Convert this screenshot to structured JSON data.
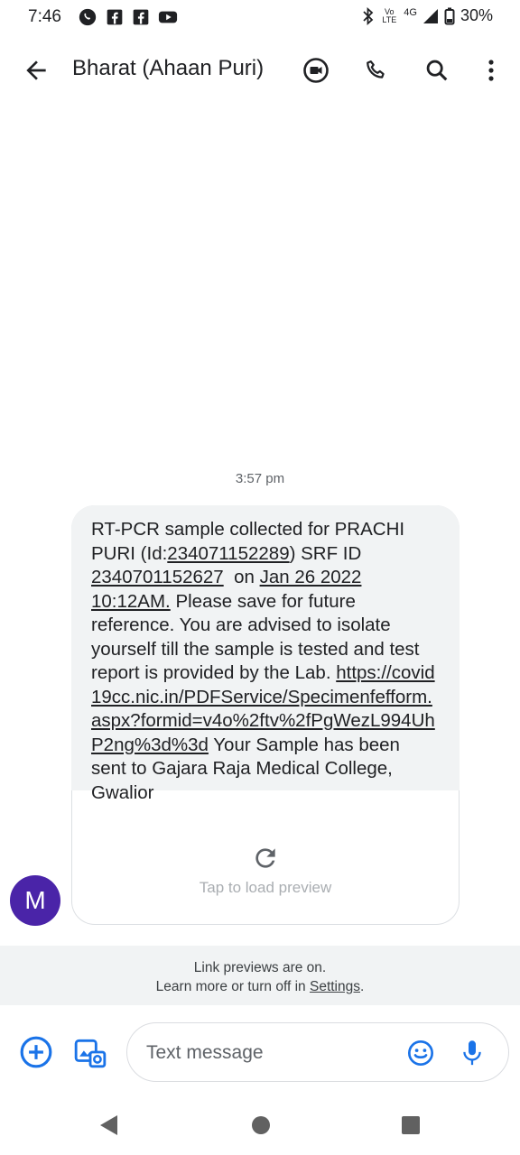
{
  "status_bar": {
    "time": "7:46",
    "battery": "30%",
    "network": "4G",
    "volte_top": "Vo",
    "volte_bottom": "LTE"
  },
  "app_bar": {
    "title": "Bharat (Ahaan Puri)"
  },
  "conversation": {
    "timestamp": "3:57 pm",
    "avatar_letter": "M",
    "avatar_color": "#4a24a8",
    "message": {
      "t1": "RT-PCR sample collected for PRACHI PURI (Id:",
      "id_link": "234071152289",
      "t2": ") SRF ID ",
      "srf_link": "2340701152627",
      "t3": "  on ",
      "date_link": "Jan 26 2022 10:12AM.",
      "t4": " Please save for future reference. You are advised to isolate yourself till the sample is tested and test report is provided by the Lab. ",
      "url_link": "https://covid19cc.nic.in/PDFService/Specimenfefform.aspx?formid=v4o%2ftv%2fPgWezL994UhP2ng%3d%3d",
      "t5": " Your Sample has been sent to Gajara Raja Medical College, Gwalior"
    },
    "preview": {
      "label": "Tap to load preview"
    }
  },
  "link_notice": {
    "line1": "Link previews are on.",
    "line2_prefix": "Learn more or turn off in ",
    "settings": "Settings",
    "line2_suffix": "."
  },
  "compose": {
    "placeholder": "Text message"
  },
  "colors": {
    "accent": "#1a73e8",
    "bubble_bg": "#f1f3f4"
  }
}
